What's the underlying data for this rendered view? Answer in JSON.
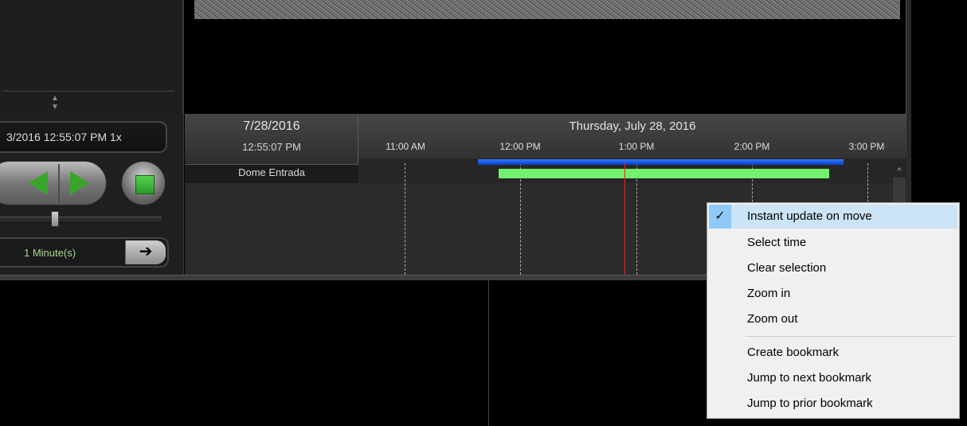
{
  "player": {
    "timestamp_display": "3/2016 12:55:07 PM 1x",
    "interval_label": "1 Minute(s)",
    "go_arrow": "➔",
    "collapse_arrows": "▲ ▼"
  },
  "timeline": {
    "current_date": "7/28/2016",
    "current_time": "12:55:07 PM",
    "camera_name": "Dome Entrada",
    "header_date": "Thursday, July 28, 2016",
    "ticks": [
      "11:00 AM",
      "12:00 PM",
      "1:00 PM",
      "2:00 PM",
      "3:00 PM"
    ],
    "scroll_up_glyph": "^"
  },
  "context_menu": {
    "check_glyph": "✓",
    "items": [
      {
        "label": "Instant update on move",
        "checked": true
      },
      {
        "label": "Select time"
      },
      {
        "label": "Clear selection"
      },
      {
        "label": "Zoom in"
      },
      {
        "label": "Zoom out"
      },
      {
        "label": "Create bookmark"
      },
      {
        "label": "Jump to next bookmark"
      },
      {
        "label": "Jump to prior bookmark"
      }
    ]
  },
  "colors": {
    "recording_bar": "#73f06e",
    "selection_bar": "#1d5cf0",
    "playhead": "#ff1a1a",
    "transport_green": "#3aa52c"
  }
}
